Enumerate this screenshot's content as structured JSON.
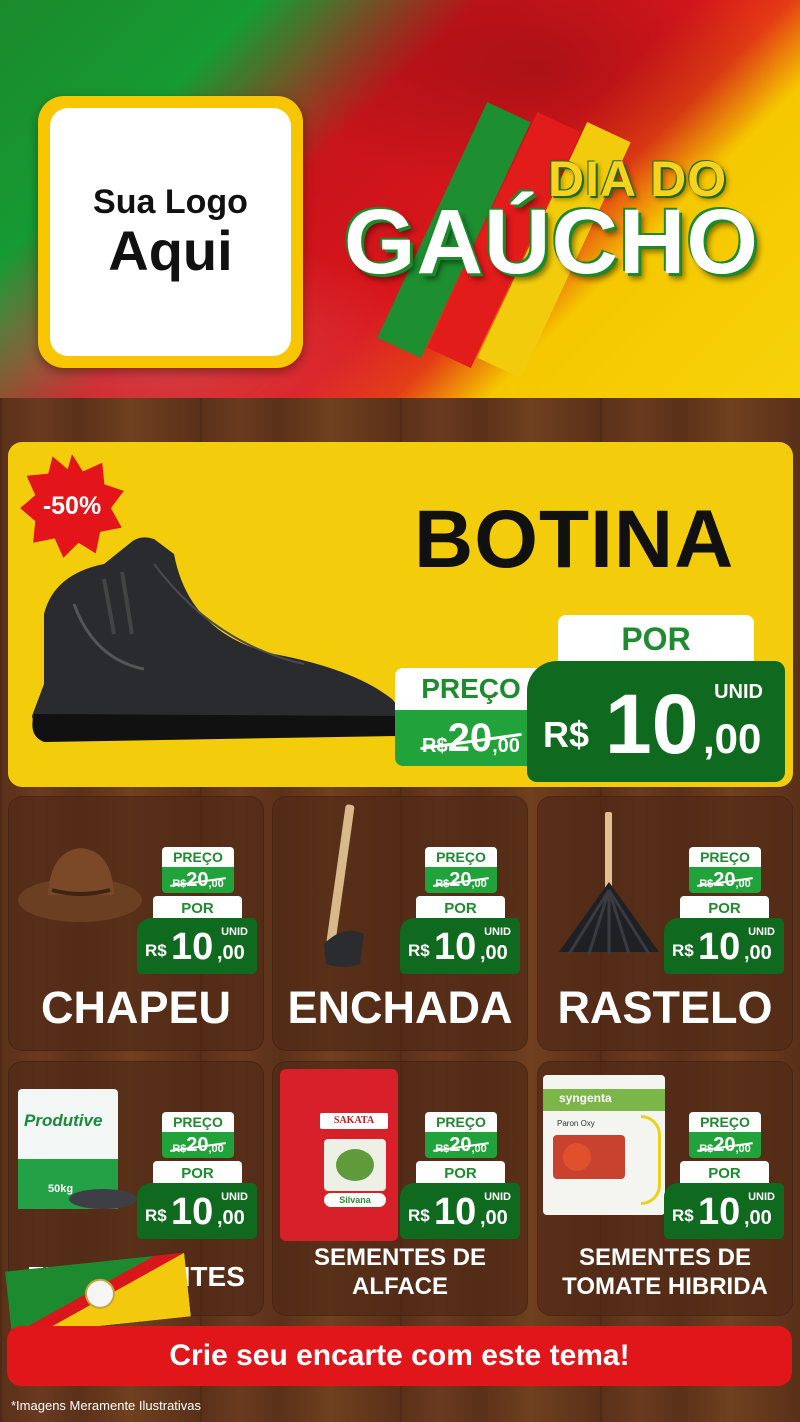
{
  "header": {
    "logo_line1": "Sua Logo",
    "logo_line2": "Aqui",
    "title_line1": "DIA DO",
    "title_line2": "GAÚCHO"
  },
  "featured": {
    "badge": "-50%",
    "name": "BOTINA",
    "preco_label": "PREÇO",
    "old_currency": "R$",
    "old_int": "20",
    "old_cents": ",00",
    "por_label": "POR",
    "unid_label": "UNID",
    "new_currency": "R$",
    "new_int": "10",
    "new_cents": ",00"
  },
  "products": [
    {
      "name": "CHAPEU",
      "preco_label": "PREÇO",
      "old_currency": "R$",
      "old_int": "20",
      "old_cents": ",00",
      "por_label": "POR",
      "unid_label": "UNID",
      "new_currency": "R$",
      "new_int": "10",
      "new_cents": ",00"
    },
    {
      "name": "ENCHADA",
      "preco_label": "PREÇO",
      "old_currency": "R$",
      "old_int": "20",
      "old_cents": ",00",
      "por_label": "POR",
      "unid_label": "UNID",
      "new_currency": "R$",
      "new_int": "10",
      "new_cents": ",00"
    },
    {
      "name": "RASTELO",
      "preco_label": "PREÇO",
      "old_currency": "R$",
      "old_int": "20",
      "old_cents": ",00",
      "por_label": "POR",
      "unid_label": "UNID",
      "new_currency": "R$",
      "new_int": "10",
      "new_cents": ",00"
    },
    {
      "name": "FERTILIZANTES",
      "preco_label": "PREÇO",
      "old_currency": "R$",
      "old_int": "20",
      "old_cents": ",00",
      "por_label": "POR",
      "unid_label": "UNID",
      "new_currency": "R$",
      "new_int": "10",
      "new_cents": ",00",
      "package_brand": "Produtive",
      "package_weight": "50kg"
    },
    {
      "name_line1": "SEMENTES DE",
      "name_line2": "ALFACE",
      "preco_label": "PREÇO",
      "old_currency": "R$",
      "old_int": "20",
      "old_cents": ",00",
      "por_label": "POR",
      "unid_label": "UNID",
      "new_currency": "R$",
      "new_int": "10",
      "new_cents": ",00",
      "package_brand": "SAKATA",
      "package_brand2": "Silvana"
    },
    {
      "name_line1": "SEMENTES DE",
      "name_line2": "TOMATE HIBRIDA",
      "preco_label": "PREÇO",
      "old_currency": "R$",
      "old_int": "20",
      "old_cents": ",00",
      "por_label": "POR",
      "unid_label": "UNID",
      "new_currency": "R$",
      "new_int": "10",
      "new_cents": ",00",
      "package_brand": "syngenta",
      "package_variety": "Paron Oxy"
    }
  ],
  "cta": {
    "label": "Crie seu encarte com este tema!"
  },
  "disclaimer": "*Imagens Meramente Ilustrativas",
  "colors": {
    "yellow": "#f3cd0b",
    "green_dark": "#0f6a1f",
    "green": "#22a23a",
    "red": "#e0161b",
    "wood": "#5a3019"
  }
}
